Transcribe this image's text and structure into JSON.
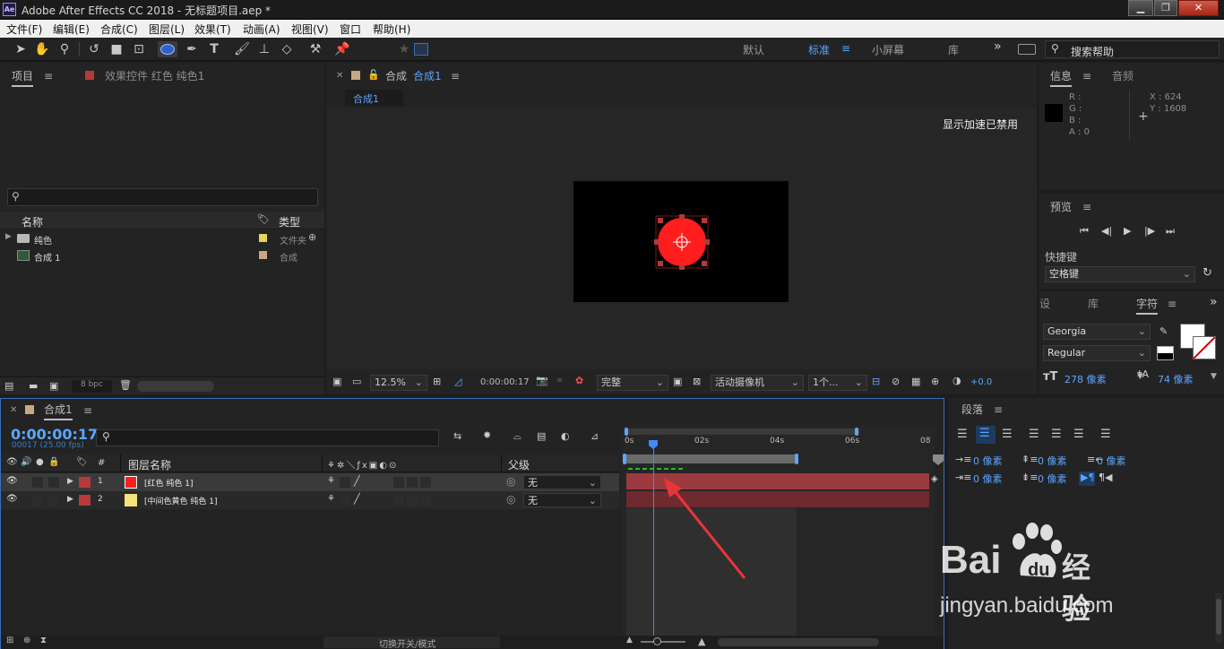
{
  "window": {
    "app_icon": "Ae",
    "title": "Adobe After Effects CC 2018 - 无标题项目.aep *",
    "min": "▁",
    "max": "❐",
    "close": "✕"
  },
  "menu": [
    "文件(F)",
    "编辑(E)",
    "合成(C)",
    "图层(L)",
    "效果(T)",
    "动画(A)",
    "视图(V)",
    "窗口",
    "帮助(H)"
  ],
  "workspaces": {
    "default": "默认",
    "standard": "标准",
    "small_screen": "小屏幕",
    "library": "库",
    "more": "»"
  },
  "search_help": {
    "placeholder": "搜索帮助"
  },
  "project_panel": {
    "tab_project": "项目",
    "tab_effects": "效果控件 红色 纯色1",
    "col_name": "名称",
    "col_type": "类型",
    "items": [
      {
        "name": "纯色",
        "type": "文件夹",
        "color": "#e6d25a"
      },
      {
        "name": "合成 1",
        "type": "合成",
        "color": "#c8a882"
      }
    ],
    "bpc": "8 bpc"
  },
  "composition_panel": {
    "tab": "合成",
    "tab_comp_name": "合成1",
    "breadcrumb": "合成1",
    "accel_notice": "显示加速已禁用",
    "zoom": "12.5%",
    "timecode": "0:00:00:17",
    "quality": "完整",
    "camera": "活动摄像机",
    "views": "1个...",
    "exposure": "+0.0"
  },
  "info_panel": {
    "tab_info": "信息",
    "tab_audio": "音频",
    "r": "R :",
    "g": "G :",
    "b": "B :",
    "a": "A : 0",
    "x": "X : 624",
    "y": "Y : 1608"
  },
  "preview_panel": {
    "title": "预览",
    "shortcut_label": "快捷键",
    "shortcut_value": "空格键"
  },
  "character_panel": {
    "tab_settings": "设",
    "tab_library": "库",
    "tab_character": "字符",
    "font": "Georgia",
    "style": "Regular",
    "size": "278 像素",
    "leading": "74 像素"
  },
  "paragraph_panel": {
    "title": "段落",
    "indent_left": "0 像素",
    "indent_first": "0 像素",
    "indent_right": "0 像素",
    "space_before": "0 像素",
    "space_after": "0 像素",
    "space_extra": "0 像素"
  },
  "timeline": {
    "tab": "合成1",
    "timecode": "0:00:00:17",
    "frames": "00017 (25.00 fps)",
    "col_hash": "#",
    "col_layer_name": "图层名称",
    "col_parent": "父级",
    "layers": [
      {
        "num": "1",
        "name": "[红色 纯色 1]",
        "color": "#ff1d1d",
        "parent": "无"
      },
      {
        "num": "2",
        "name": "[中间色黄色 纯色 1]",
        "color": "#f4e27a",
        "parent": "无"
      }
    ],
    "ruler": [
      "0s",
      "02s",
      "04s",
      "06s",
      "08"
    ],
    "toggle_modes": "切换开关/模式"
  },
  "watermark": {
    "brand_a": "Bai",
    "brand_b": "经验",
    "url": "jingyan.baidu.com"
  },
  "colors": {
    "accent": "#5ba6ff",
    "playhead": "#3a8cff",
    "red_solid": "#ff1d1d",
    "layer_bar": "#9c3a3f"
  }
}
